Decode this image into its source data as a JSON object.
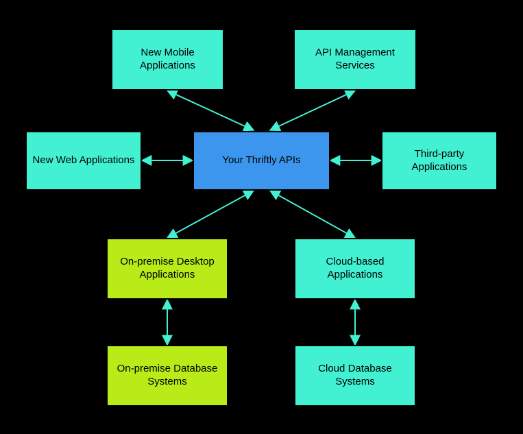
{
  "nodes": {
    "new_mobile": {
      "label": "New Mobile Applications"
    },
    "api_mgmt": {
      "label": "API Management Services"
    },
    "new_web": {
      "label": "New Web Applications"
    },
    "thriftly_apis": {
      "label": "Your Thriftly APIs"
    },
    "third_party": {
      "label": "Third-party Applications"
    },
    "onprem_desktop": {
      "label": "On-premise Desktop Applications"
    },
    "cloud_apps": {
      "label": "Cloud-based Applications"
    },
    "onprem_db": {
      "label": "On-premise Database Systems"
    },
    "cloud_db": {
      "label": "Cloud Database Systems"
    }
  },
  "colors": {
    "teal": "#42F1D2",
    "blue": "#3C96ED",
    "green": "#B8EB18"
  },
  "edges": [
    {
      "from": "new_mobile",
      "to": "thriftly_apis",
      "bidirectional": true
    },
    {
      "from": "api_mgmt",
      "to": "thriftly_apis",
      "bidirectional": true
    },
    {
      "from": "new_web",
      "to": "thriftly_apis",
      "bidirectional": true
    },
    {
      "from": "third_party",
      "to": "thriftly_apis",
      "bidirectional": true
    },
    {
      "from": "onprem_desktop",
      "to": "thriftly_apis",
      "bidirectional": true
    },
    {
      "from": "cloud_apps",
      "to": "thriftly_apis",
      "bidirectional": true
    },
    {
      "from": "onprem_desktop",
      "to": "onprem_db",
      "bidirectional": true
    },
    {
      "from": "cloud_apps",
      "to": "cloud_db",
      "bidirectional": true
    }
  ]
}
